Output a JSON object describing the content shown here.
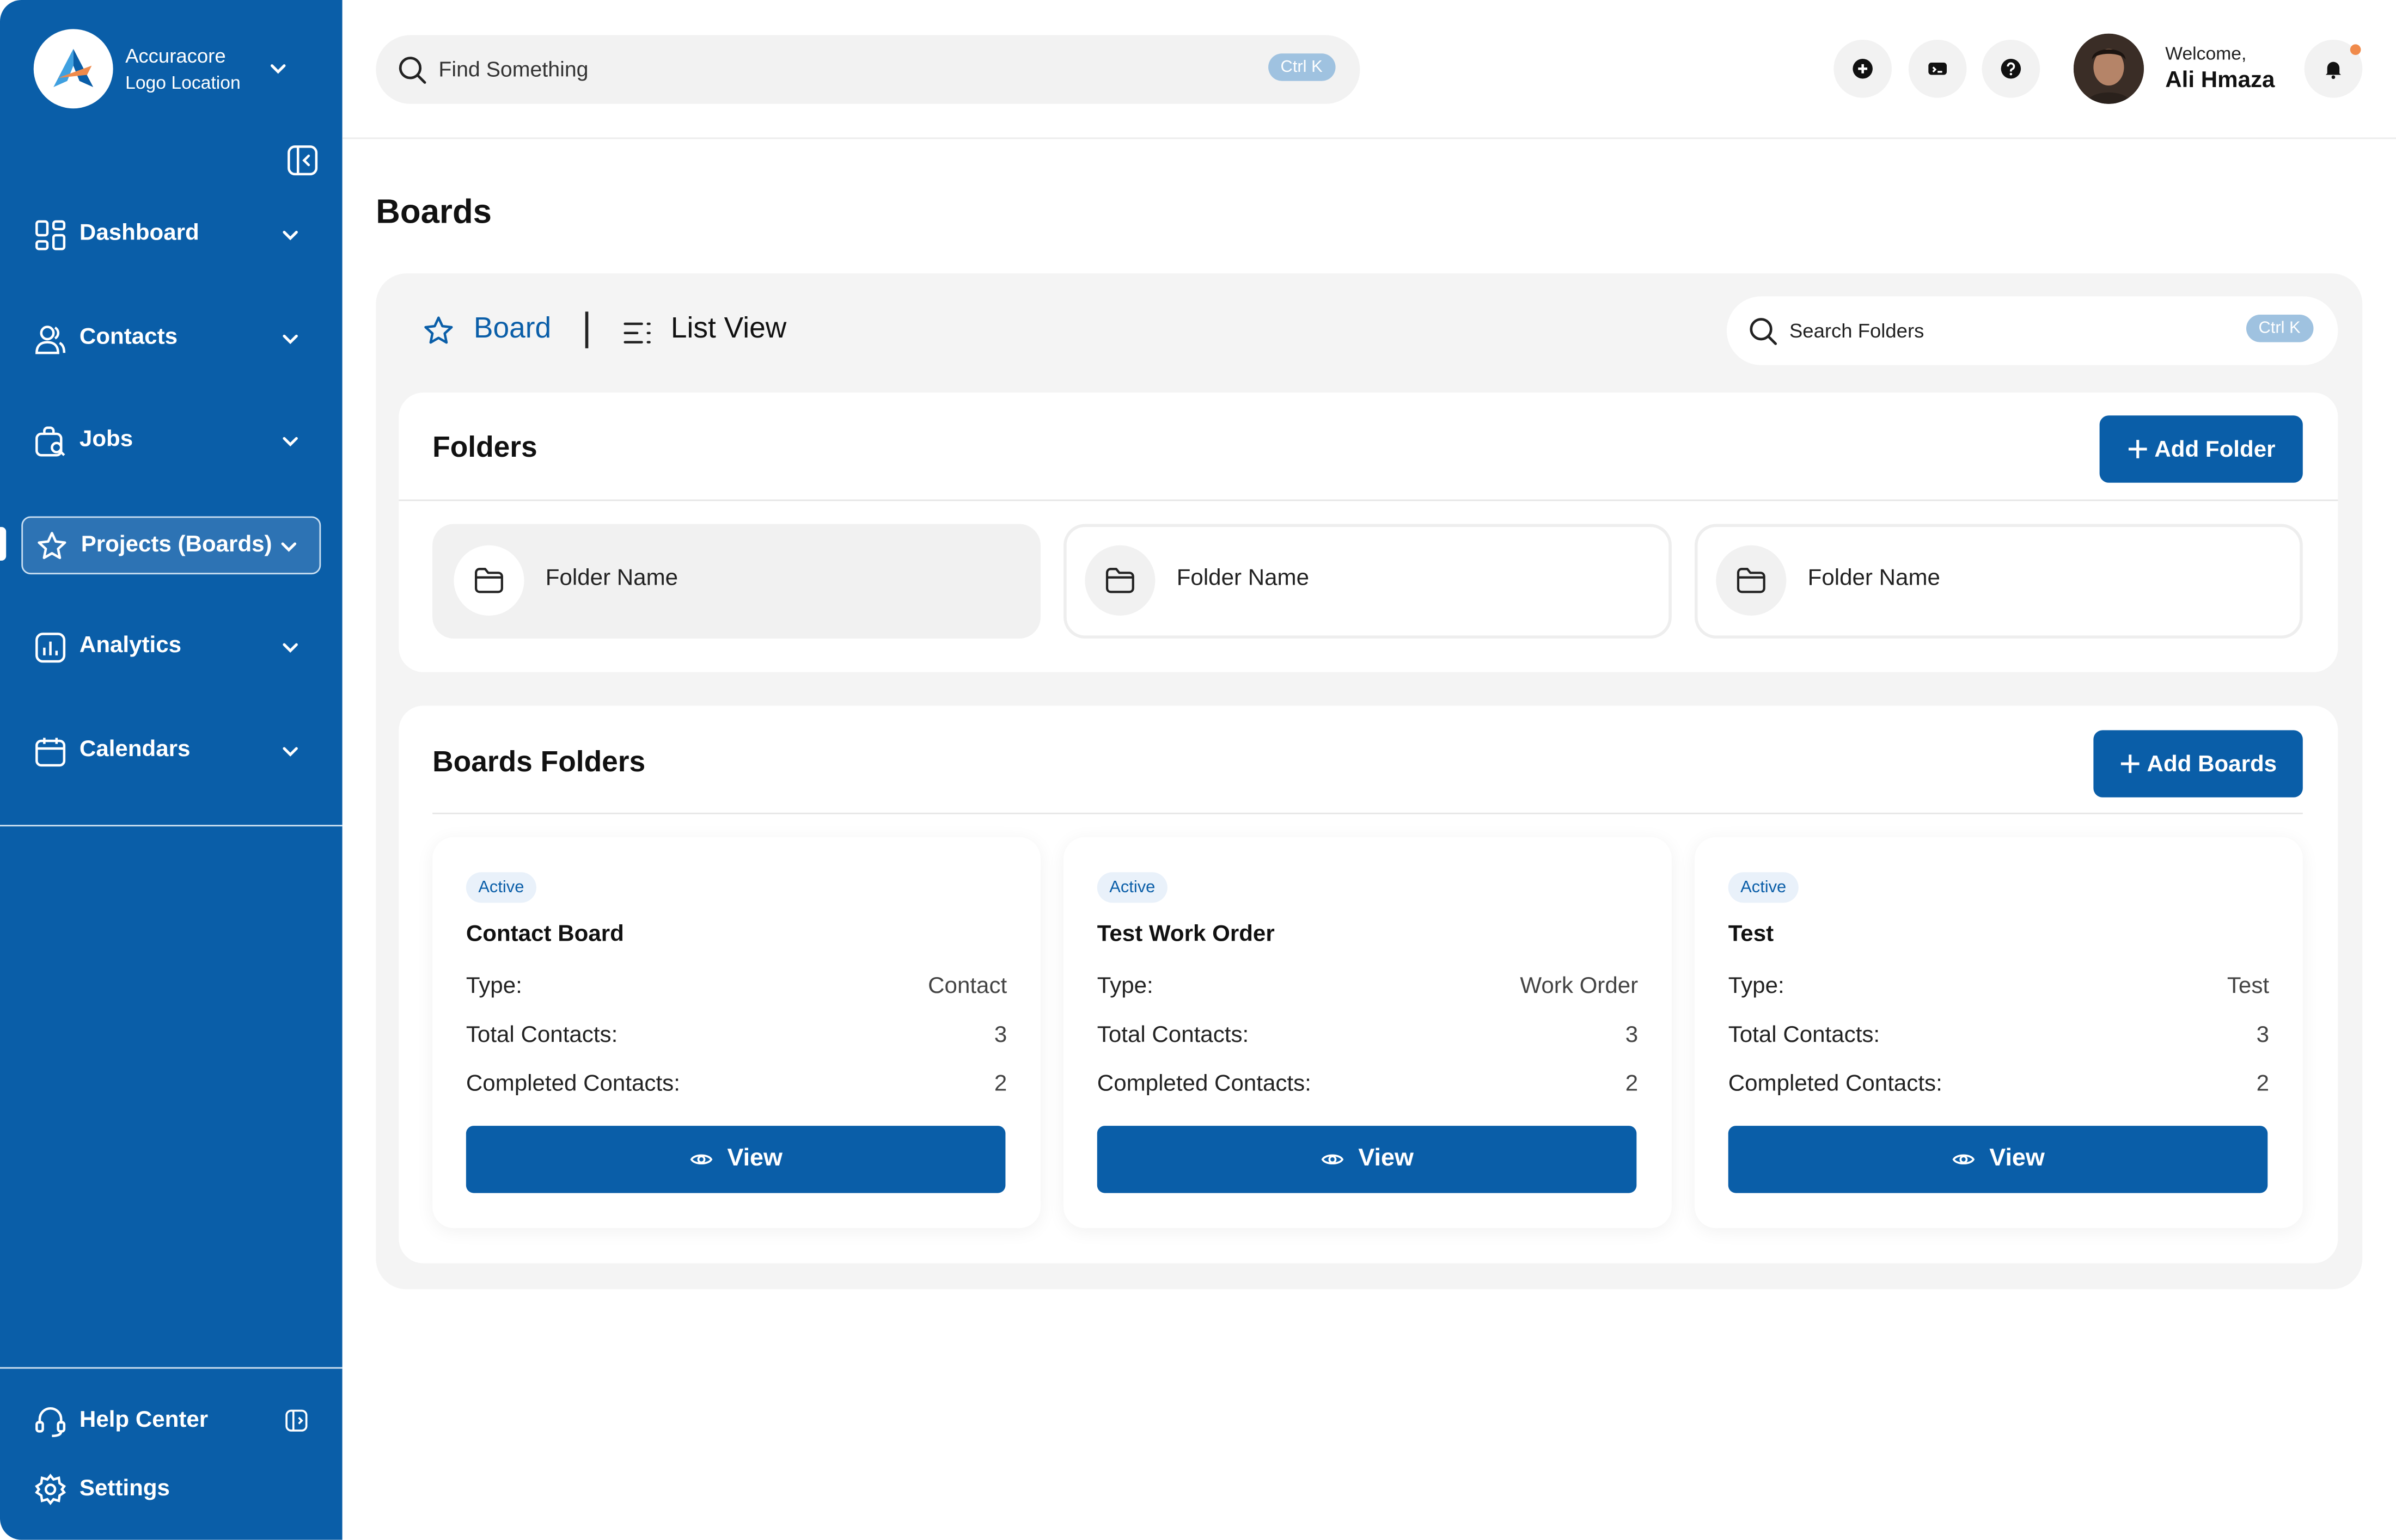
{
  "brand": {
    "name": "Accuracore",
    "sub": "Logo Location"
  },
  "nav": {
    "items": [
      {
        "label": "Dashboard",
        "icon": "dashboard-grid-icon"
      },
      {
        "label": "Contacts",
        "icon": "contacts-icon"
      },
      {
        "label": "Jobs",
        "icon": "jobs-icon"
      },
      {
        "label": "Projects (Boards)",
        "icon": "projects-icon",
        "active": true
      },
      {
        "label": "Analytics",
        "icon": "analytics-icon"
      },
      {
        "label": "Calendars",
        "icon": "calendar-icon"
      }
    ],
    "footer": [
      {
        "label": "Help Center",
        "icon": "headset-icon"
      },
      {
        "label": "Settings",
        "icon": "gear-icon"
      }
    ]
  },
  "topbar": {
    "search_placeholder": "Find Something",
    "search_shortcut": "Ctrl K",
    "welcome": "Welcome,",
    "user_name": "Ali Hmaza"
  },
  "page": {
    "title": "Boards",
    "tabs": [
      {
        "label": "Board",
        "active": true
      },
      {
        "label": "List View",
        "active": false
      }
    ],
    "folder_search_placeholder": "Search Folders",
    "folder_search_shortcut": "Ctrl K"
  },
  "folders": {
    "title": "Folders",
    "add_label": "Add Folder",
    "items": [
      "Folder Name",
      "Folder Name",
      "Folder Name"
    ]
  },
  "boards": {
    "title": "Boards Folders",
    "add_label": "Add Boards",
    "labels": {
      "type": "Type:",
      "total": "Total Contacts:",
      "completed": "Completed Contacts:",
      "view": "View"
    },
    "items": [
      {
        "status": "Active",
        "name": "Contact Board",
        "type": "Contact",
        "total": "3",
        "completed": "2"
      },
      {
        "status": "Active",
        "name": "Test Work Order",
        "type": "Work Order",
        "total": "3",
        "completed": "2"
      },
      {
        "status": "Active",
        "name": "Test",
        "type": "Test",
        "total": "3",
        "completed": "2"
      }
    ]
  },
  "colors": {
    "primary": "#0a5ea8",
    "panel": "#f4f4f4",
    "badge_bg": "#e9f1fa",
    "notification": "#f08a4b"
  }
}
